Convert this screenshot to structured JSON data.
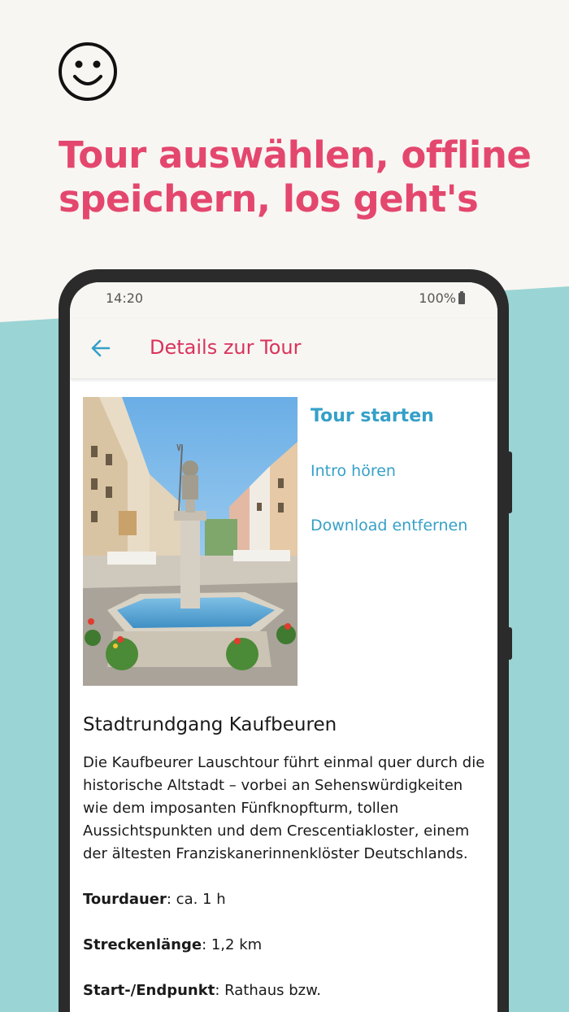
{
  "headline": {
    "line1": "Tour auswählen, offline",
    "line2": "speichern, los geht's"
  },
  "colors": {
    "accent": "#e4476e",
    "teal": "#9bd4d5",
    "link": "#35a0c8",
    "background": "#f8f6f2"
  },
  "statusbar": {
    "time": "14:20",
    "battery": "100%"
  },
  "appbar": {
    "title": "Details zur Tour"
  },
  "actions": {
    "start": "Tour starten",
    "intro": "Intro hören",
    "download": "Download entfernen"
  },
  "tour": {
    "title": "Stadtrundgang Kaufbeuren",
    "description": "Die Kaufbeurer Lauschtour führt einmal quer durch die historische Altstadt – vorbei an Sehenswürdigkeiten wie dem imposanten Fünfknopfturm, tollen Aussichtspunkten und dem Crescentiakloster, einem der ältesten Franziskanerinnenklöster Deutschlands.",
    "facts": [
      {
        "label": "Tourdauer",
        "value": ": ca. 1 h"
      },
      {
        "label": "Streckenlänge",
        "value": ": 1,2 km"
      },
      {
        "label": "Start-/Endpunkt",
        "value": ": Rathaus bzw."
      }
    ]
  },
  "icons": {
    "smiley": "smiley-icon",
    "back": "arrow-back-icon",
    "battery": "battery-icon"
  }
}
